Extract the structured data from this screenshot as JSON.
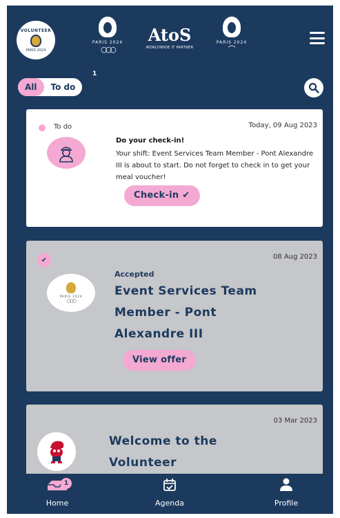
{
  "header": {
    "volunteer_logo_text": "VOLUNTEER",
    "volunteer_logo_sub": "PARIS 2024",
    "olympic_text": "PARIS 2024",
    "atos_brand": "AtoS",
    "atos_sub": "WORLDWIDE IT PARTNER",
    "paralympic_text": "PARIS 2024"
  },
  "filter": {
    "all_label": "All",
    "todo_label": "To do",
    "todo_count": "1"
  },
  "card1": {
    "status": "To do",
    "date": "Today, 09 Aug 2023",
    "title": "Do your check-in!",
    "body": "Your shift: Event Services Team Member - Pont Alexandre III is about to start. Do not forget to check in to get your meal voucher!",
    "button": "Check-in ✔"
  },
  "card2": {
    "date": "08 Aug 2023",
    "logo_text": "PARIS 2024",
    "status": "Accepted",
    "title": "Event Services Team Member - Pont Alexandre III",
    "button": "View offer"
  },
  "card3": {
    "date": "03 Mar 2023",
    "title": "Welcome to the Volunteer"
  },
  "bottom_nav": {
    "home_label": "Home",
    "home_badge": "1",
    "agenda_label": "Agenda",
    "profile_label": "Profile"
  },
  "colors": {
    "background": "#1c3a5e",
    "accent_pink": "#f4a9d2",
    "card_grey": "#c6c7ca"
  }
}
